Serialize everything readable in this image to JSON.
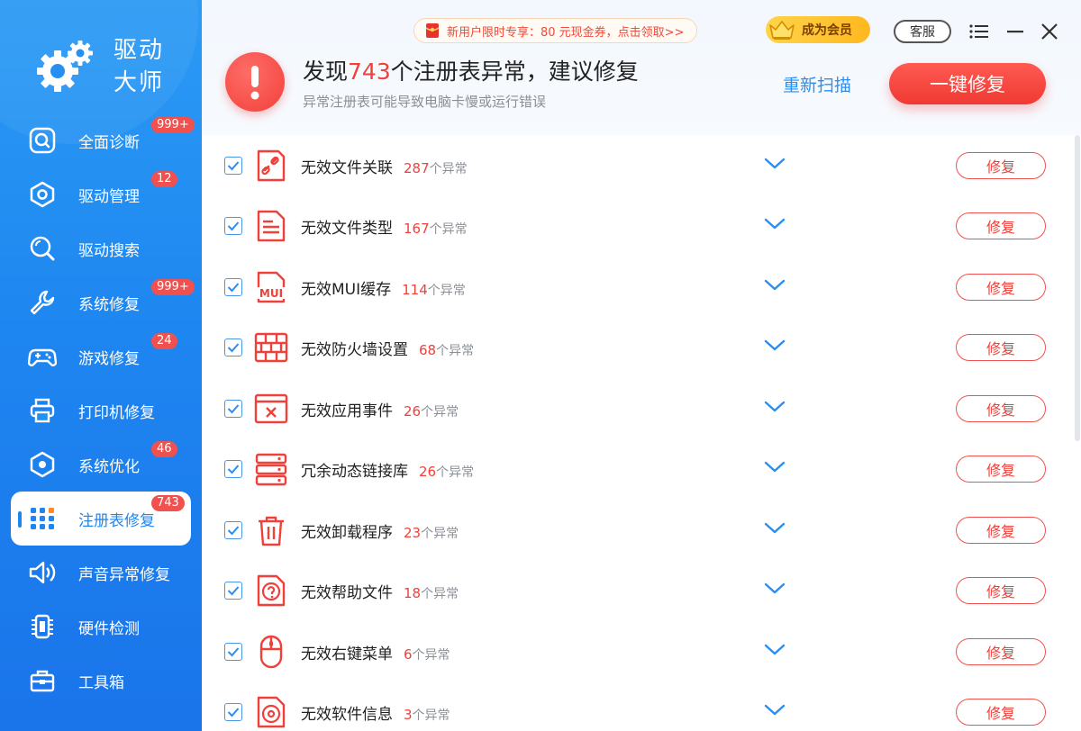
{
  "app": {
    "title_line1": "驱动",
    "title_line2": "大师"
  },
  "sidebar": {
    "items": [
      {
        "label": "全面诊断",
        "badge": "999+",
        "icon": "search-box-icon"
      },
      {
        "label": "驱动管理",
        "badge": "12",
        "icon": "hexagon-icon"
      },
      {
        "label": "驱动搜索",
        "badge": "",
        "icon": "magnifier-icon"
      },
      {
        "label": "系统修复",
        "badge": "999+",
        "icon": "wrench-icon"
      },
      {
        "label": "游戏修复",
        "badge": "24",
        "icon": "gamepad-icon"
      },
      {
        "label": "打印机修复",
        "badge": "",
        "icon": "printer-icon"
      },
      {
        "label": "系统优化",
        "badge": "46",
        "icon": "optimize-icon"
      },
      {
        "label": "注册表修复",
        "badge": "743",
        "icon": "grid-icon"
      },
      {
        "label": "声音异常修复",
        "badge": "",
        "icon": "speaker-icon"
      },
      {
        "label": "硬件检测",
        "badge": "",
        "icon": "chip-icon"
      },
      {
        "label": "工具箱",
        "badge": "",
        "icon": "toolbox-icon"
      }
    ]
  },
  "header": {
    "promo": "新用户限时专享：80 元现金券，点击领取>>",
    "vip": "成为会员",
    "service": "客服",
    "title_prefix": "发现",
    "title_count": "743",
    "title_suffix": "个注册表异常，建议修复",
    "subtitle": "异常注册表可能导致电脑卡慢或运行错误",
    "rescan": "重新扫描",
    "fix_all": "一键修复"
  },
  "list": {
    "unit": "个异常",
    "fix_label": "修复",
    "rows": [
      {
        "label": "无效文件关联",
        "count": "287",
        "icon": "broken-link-icon"
      },
      {
        "label": "无效文件类型",
        "count": "167",
        "icon": "document-icon"
      },
      {
        "label": "无效MUI缓存",
        "count": "114",
        "icon": "mui-file-icon"
      },
      {
        "label": "无效防火墙设置",
        "count": "68",
        "icon": "firewall-icon"
      },
      {
        "label": "无效应用事件",
        "count": "26",
        "icon": "window-error-icon"
      },
      {
        "label": "冗余动态链接库",
        "count": "26",
        "icon": "server-stack-icon"
      },
      {
        "label": "无效卸载程序",
        "count": "23",
        "icon": "trash-icon"
      },
      {
        "label": "无效帮助文件",
        "count": "18",
        "icon": "help-file-icon"
      },
      {
        "label": "无效右键菜单",
        "count": "6",
        "icon": "mouse-icon"
      },
      {
        "label": "无效软件信息",
        "count": "3",
        "icon": "disc-file-icon"
      }
    ]
  },
  "colors": {
    "accent_blue": "#1f86f0",
    "accent_red": "#f0403a"
  }
}
